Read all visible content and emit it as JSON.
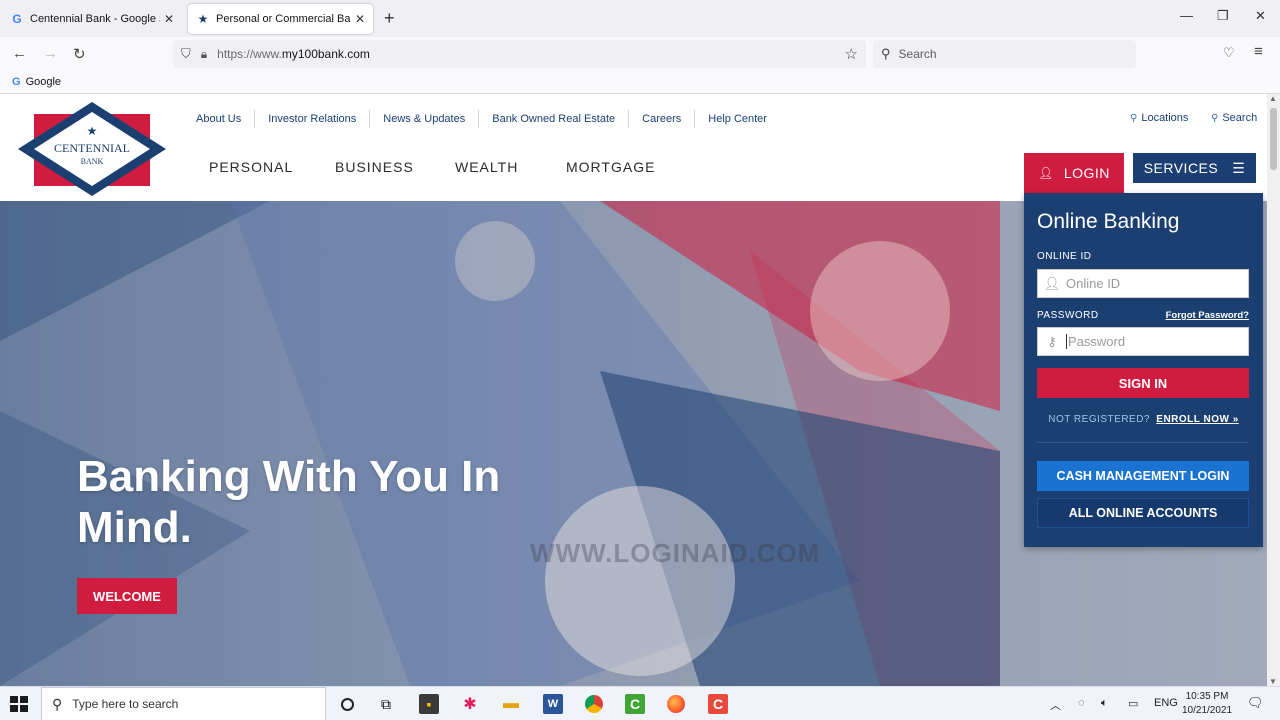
{
  "browser": {
    "tabs": [
      {
        "title": "Centennial Bank - Google Search",
        "icon": "google-icon"
      },
      {
        "title": "Personal or Commercial Banking",
        "icon": "star-icon"
      }
    ],
    "url_prefix": "https://www.",
    "url_domain": "my100bank.com",
    "search_placeholder": "Search",
    "bookmarks": [
      {
        "label": "Google"
      }
    ]
  },
  "site": {
    "logo": {
      "line1": "CENTENNIAL",
      "line2": "BANK"
    },
    "top_links": [
      "About Us",
      "Investor Relations",
      "News & Updates",
      "Bank Owned Real Estate",
      "Careers",
      "Help Center"
    ],
    "utility": {
      "locations": "Locations",
      "search": "Search"
    },
    "main_nav": [
      "PERSONAL",
      "BUSINESS",
      "WEALTH",
      "MORTGAGE"
    ],
    "login_label": "LOGIN",
    "services_label": "SERVICES",
    "hero": {
      "title": "Banking With You In Mind.",
      "button": "WELCOME",
      "watermark": "WWW.LOGINAID.COM"
    },
    "login_panel": {
      "heading": "Online Banking",
      "online_id_label": "ONLINE ID",
      "online_id_placeholder": "Online ID",
      "password_label": "PASSWORD",
      "forgot_password": "Forgot Password?",
      "password_placeholder": "Password",
      "sign_in": "SIGN IN",
      "not_registered": "NOT REGISTERED?",
      "enroll": "ENROLL NOW »",
      "cash_management": "CASH MANAGEMENT LOGIN",
      "all_accounts": "ALL ONLINE ACCOUNTS"
    },
    "colors": {
      "brand_blue": "#1c3f71",
      "brand_red": "#d01c3f",
      "link_blue": "#1a73d1"
    }
  },
  "taskbar": {
    "search_placeholder": "Type here to search",
    "language": "ENG",
    "time": "10:35 PM",
    "date": "10/21/2021"
  }
}
